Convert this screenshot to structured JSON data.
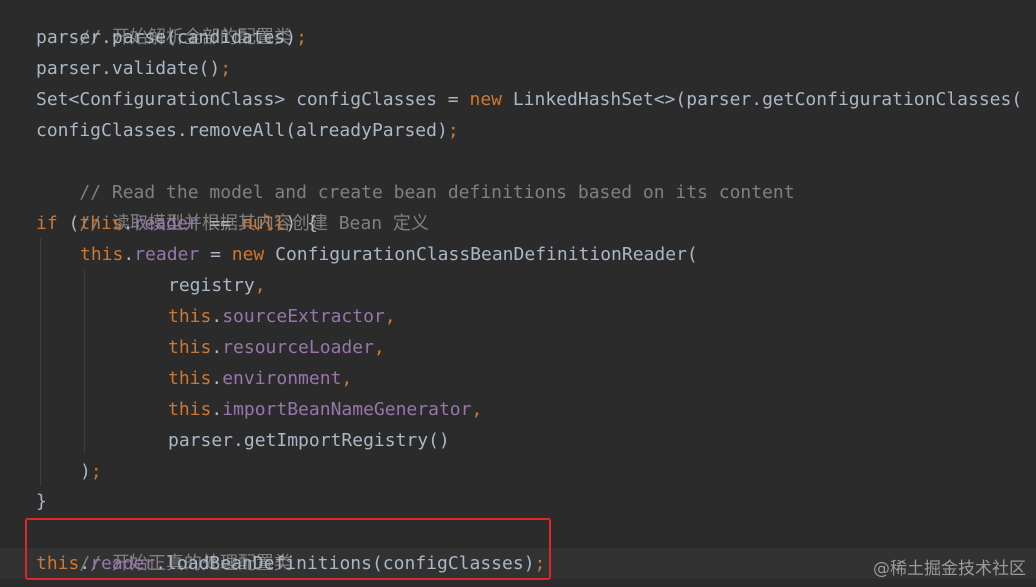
{
  "code": {
    "l0": {
      "comment": "// 开始解析全部的配置类"
    },
    "l1": {
      "a": "parser.parse(candidates)",
      "semi": ";"
    },
    "l2": {
      "a": "parser.validate()",
      "semi": ";"
    },
    "l3": {
      "a": "Set<ConfigurationClass> configClasses = ",
      "kw_new": "new",
      "b": " LinkedHashSet<>(parser.getConfigurationClasses("
    },
    "l4": {
      "a": "configClasses.removeAll(alreadyParsed)",
      "semi": ";"
    },
    "l5": {
      "comment": "// Read the model and create bean definitions based on its content"
    },
    "l6": {
      "comment": "// 读取模型并根据其内容创建 Bean 定义"
    },
    "l7": {
      "kw_if": "if",
      "a": " (",
      "kw_this": "this",
      "dot": ".",
      "fld": "reader",
      "b": " == ",
      "kw_null": "null",
      "c": ") {"
    },
    "l8": {
      "kw_this": "this",
      "dot": ".",
      "fld": "reader",
      "a": " = ",
      "kw_new": "new",
      "b": " ConfigurationClassBeanDefinitionReader("
    },
    "l9": {
      "a": "registry",
      "comma": ","
    },
    "l10": {
      "kw_this": "this",
      "dot": ".",
      "fld": "sourceExtractor",
      "comma": ","
    },
    "l11": {
      "kw_this": "this",
      "dot": ".",
      "fld": "resourceLoader",
      "comma": ","
    },
    "l12": {
      "kw_this": "this",
      "dot": ".",
      "fld": "environment",
      "comma": ","
    },
    "l13": {
      "kw_this": "this",
      "dot": ".",
      "fld": "importBeanNameGenerator",
      "comma": ","
    },
    "l14": {
      "a": "parser.getImportRegistry()"
    },
    "l15": {
      "a": ")",
      "semi": ";"
    },
    "l16": {
      "a": "}"
    },
    "l17": {
      "comment": "// 开始正真的处理配置类"
    },
    "l18": {
      "kw_this": "this",
      "dot": ".",
      "fld": "reader",
      "a": ".loadBeanDefinitions(configClasses)",
      "semi": ";"
    }
  },
  "watermark": "@稀土掘金技术社区",
  "colors": {
    "background": "#2b2b2b",
    "text": "#a9b7c6",
    "keyword": "#cc7832",
    "field": "#9876aa",
    "comment": "#808080",
    "highlight_box": "#e0242b"
  }
}
